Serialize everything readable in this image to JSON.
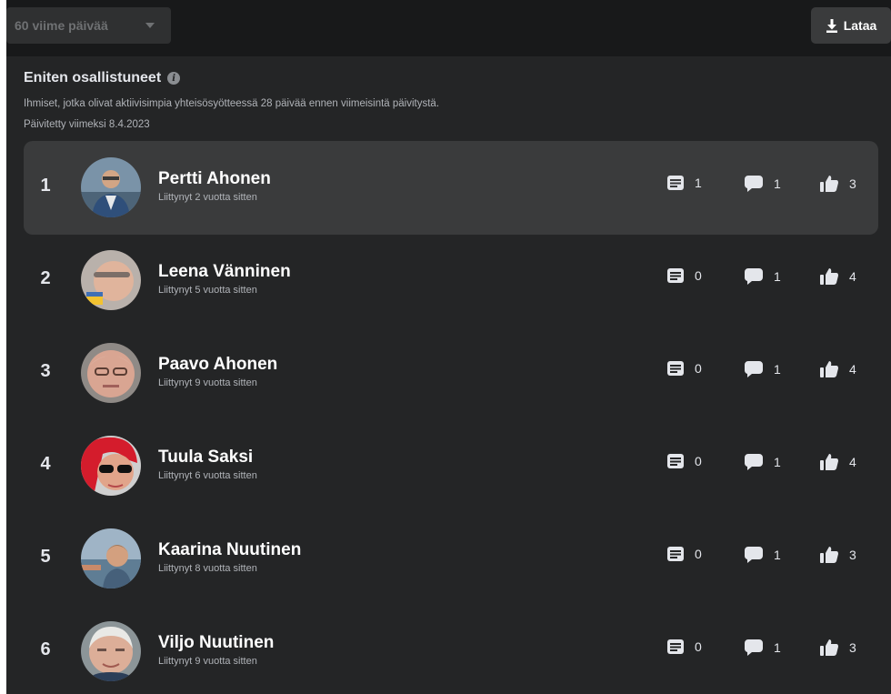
{
  "toolbar": {
    "range_label": "60 viime päivää",
    "download_label": "Lataa"
  },
  "section": {
    "title": "Eniten osallistuneet",
    "description": "Ihmiset, jotka olivat aktiivisimpia yhteisösyötteessä 28 päivää ennen viimeisintä päivitystä.",
    "updated": "Päivitetty viimeksi 8.4.2023"
  },
  "members": [
    {
      "rank": "1",
      "name": "Pertti Ahonen",
      "joined": "Liittynyt 2 vuotta sitten",
      "posts": "1",
      "comments": "1",
      "likes": "3"
    },
    {
      "rank": "2",
      "name": "Leena Vänninen",
      "joined": "Liittynyt 5 vuotta sitten",
      "posts": "0",
      "comments": "1",
      "likes": "4"
    },
    {
      "rank": "3",
      "name": "Paavo Ahonen",
      "joined": "Liittynyt 9 vuotta sitten",
      "posts": "0",
      "comments": "1",
      "likes": "4"
    },
    {
      "rank": "4",
      "name": "Tuula Saksi",
      "joined": "Liittynyt 6 vuotta sitten",
      "posts": "0",
      "comments": "1",
      "likes": "4"
    },
    {
      "rank": "5",
      "name": "Kaarina Nuutinen",
      "joined": "Liittynyt 8 vuotta sitten",
      "posts": "0",
      "comments": "1",
      "likes": "3"
    },
    {
      "rank": "6",
      "name": "Viljo Nuutinen",
      "joined": "Liittynyt 9 vuotta sitten",
      "posts": "0",
      "comments": "1",
      "likes": "3"
    }
  ],
  "icons": {
    "posts": "post-icon",
    "comments": "comment-icon",
    "likes": "thumbs-up-icon",
    "download": "download-icon",
    "info": "info-icon"
  },
  "colors": {
    "background": "#242526",
    "topbar": "#18191a",
    "highlight_row": "#3a3b3c",
    "text_primary": "#e4e6eb",
    "text_secondary": "#b0b3b8"
  }
}
